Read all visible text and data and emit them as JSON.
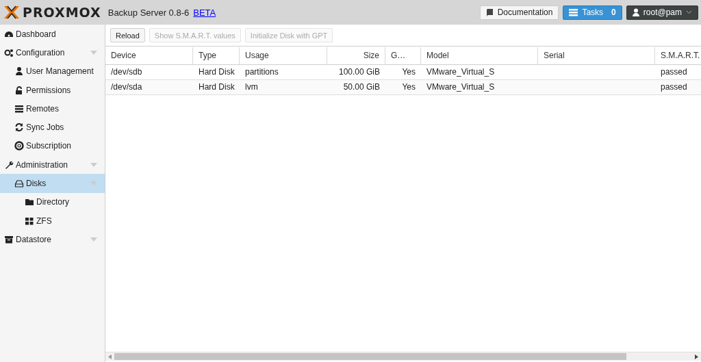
{
  "header": {
    "logo": "PROXMOX",
    "product": "Backup Server 0.8-6",
    "beta_link": "BETA",
    "docs_button": "Documentation",
    "tasks_button": "Tasks",
    "tasks_count": "0",
    "user_menu": "root@pam"
  },
  "sidebar": {
    "items": [
      {
        "label": "Dashboard",
        "selected": false
      },
      {
        "label": "Configuration",
        "selected": false,
        "expanded": true,
        "children": [
          {
            "label": "User Management",
            "selected": false
          },
          {
            "label": "Permissions",
            "selected": false
          },
          {
            "label": "Remotes",
            "selected": false
          },
          {
            "label": "Sync Jobs",
            "selected": false
          },
          {
            "label": "Subscription",
            "selected": false
          }
        ]
      },
      {
        "label": "Administration",
        "selected": false,
        "expanded": true,
        "children": [
          {
            "label": "Disks",
            "selected": true,
            "expanded": true,
            "children": [
              {
                "label": "Directory",
                "selected": false
              },
              {
                "label": "ZFS",
                "selected": false
              }
            ]
          }
        ]
      },
      {
        "label": "Datastore",
        "selected": false,
        "expanded": true
      }
    ]
  },
  "toolbar": [
    {
      "label": "Reload",
      "disabled": false
    },
    {
      "label": "Show S.M.A.R.T. values",
      "disabled": true
    },
    {
      "label": "Initialize Disk with GPT",
      "disabled": true
    }
  ],
  "table": {
    "columns": [
      "Device",
      "Type",
      "Usage",
      "Size",
      "G…",
      "Model",
      "Serial",
      "S.M.A.R.T."
    ],
    "rows": [
      [
        "/dev/sdb",
        "Hard Disk",
        "partitions",
        "100.00 GiB",
        "Yes",
        "VMware_Virtual_S",
        "",
        "passed"
      ],
      [
        "/dev/sda",
        "Hard Disk",
        "lvm",
        "50.00 GiB",
        "Yes",
        "VMware_Virtual_S",
        "",
        "passed"
      ]
    ]
  }
}
